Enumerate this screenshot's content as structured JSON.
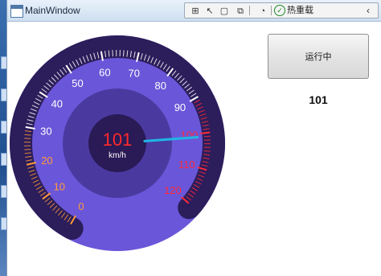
{
  "window": {
    "title": "MainWindow"
  },
  "toolbar": {
    "icons": [
      "live-visual-tree-icon",
      "select-element-icon",
      "display-layout-adorners-icon",
      "track-focus-icon",
      "binding-failures-icon"
    ],
    "hot_reload_label": "热重载",
    "collapse_glyph": "‹"
  },
  "controls": {
    "run_button_label": "运行中",
    "speed_readout": "101"
  },
  "gauge": {
    "value": 101,
    "value_text": "101",
    "unit": "km/h",
    "min": 0,
    "max": 120,
    "tick_labels": [
      "0",
      "10",
      "20",
      "30",
      "40",
      "50",
      "60",
      "70",
      "80",
      "90",
      "100",
      "110",
      "120"
    ],
    "colors": {
      "outer_ring": "#2c1d5b",
      "dial_face": "#6a56d8",
      "inner_disc": "#4a3aa0",
      "hub": "#2a1a55",
      "value_text": "#ff2a2a",
      "needle": "#1fb6e6",
      "label_low": "#ff9a3a",
      "label_mid": "#ffffff",
      "label_high": "#ff2a3a"
    }
  }
}
